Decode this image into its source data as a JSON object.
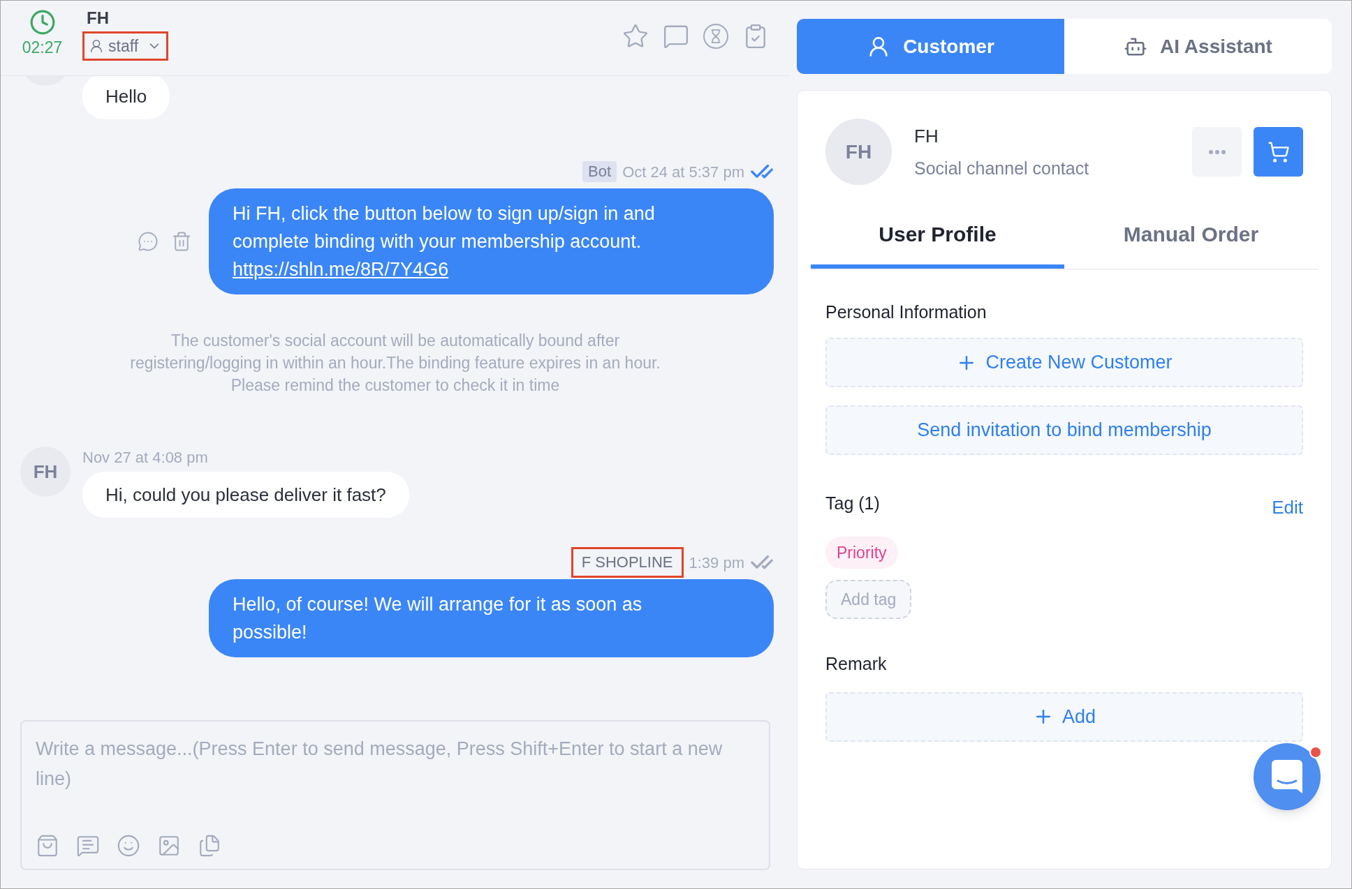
{
  "header": {
    "timer": "02:27",
    "contact_name": "FH",
    "assignee": "staff",
    "assignee_highlighted": true
  },
  "messages": [
    {
      "kind": "incoming",
      "text": "Hello"
    },
    {
      "kind": "outgoing",
      "sender": "Bot",
      "sender_badge": true,
      "highlighted": false,
      "time": "Oct 24 at 5:37 pm",
      "read": true,
      "text": "Hi FH, click the button below to sign up/sign in and complete binding with your membership account.",
      "link": "https://shln.me/8R/7Y4G6"
    },
    {
      "kind": "notice",
      "text": "The customer's social account will be automatically bound after registering/logging in within an hour.The binding feature expires in an hour. Please remind the customer to check it in time"
    },
    {
      "kind": "incoming",
      "avatar": "FH",
      "time": "Nov 27 at 4:08 pm",
      "text": "Hi, could you please deliver it fast?"
    },
    {
      "kind": "outgoing",
      "sender": "F SHOPLINE",
      "sender_badge": false,
      "highlighted": true,
      "time": "1:39 pm",
      "read": false,
      "text": "Hello, of course! We will arrange for it as soon as possible!"
    }
  ],
  "composer": {
    "placeholder": "Write a message...(Press Enter to send message, Press Shift+Enter to start a new line)"
  },
  "side_tabs": [
    {
      "label": "Customer",
      "kind": "customer",
      "selected": true
    },
    {
      "label": "AI Assistant",
      "kind": "assistant",
      "selected": false
    }
  ],
  "profile": {
    "avatar": "FH",
    "name": "FH",
    "subtitle": "Social channel contact"
  },
  "profile_tabs": [
    {
      "label": "User Profile",
      "selected": true
    },
    {
      "label": "Manual Order",
      "selected": false
    }
  ],
  "personal_information": {
    "title": "Personal Information",
    "buttons": [
      {
        "label": "Create New Customer",
        "kind": "add"
      },
      {
        "label": "Send invitation to bind membership",
        "kind": "plain"
      }
    ]
  },
  "tags": {
    "title": "Tag (1)",
    "edit": "Edit",
    "items": [
      {
        "label": "Priority",
        "color": "#e0428e"
      }
    ],
    "add_tag": "Add tag"
  },
  "remark": {
    "title": "Remark",
    "add": "Add"
  },
  "chat_launcher": {
    "unread": true
  }
}
